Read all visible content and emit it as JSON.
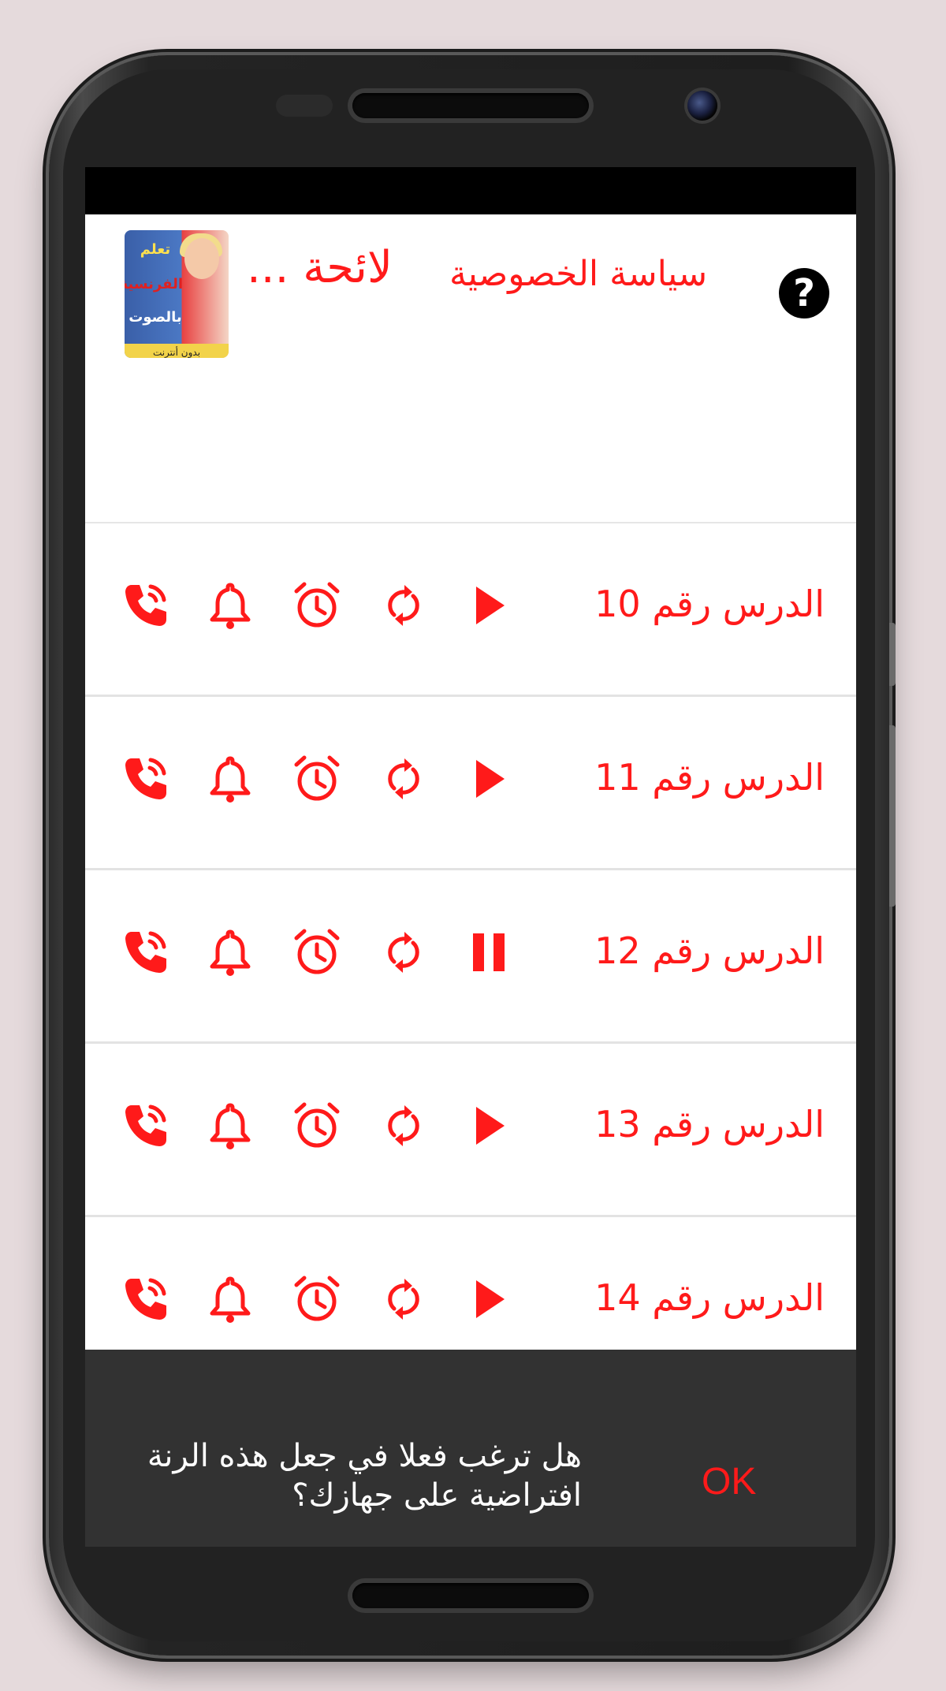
{
  "header": {
    "title": "لائحة ...",
    "privacy_label": "سياسة الخصوصية",
    "help_icon_glyph": "?",
    "logo_text": {
      "line1": "تعلم",
      "line2": "الفرنسية",
      "line3": "بالصوت",
      "bottom": "بدون أنترنت"
    }
  },
  "lessons": [
    {
      "label": "الدرس رقم 10",
      "state": "play"
    },
    {
      "label": "الدرس رقم 11",
      "state": "play"
    },
    {
      "label": "الدرس رقم 12",
      "state": "pause"
    },
    {
      "label": "الدرس رقم 13",
      "state": "play"
    },
    {
      "label": "الدرس رقم 14",
      "state": "play"
    }
  ],
  "row_icons": [
    "ringtone-call-icon",
    "notification-bell-icon",
    "alarm-clock-icon",
    "repeat-icon",
    "play-icon"
  ],
  "snackbar": {
    "message": "هل ترغب فعلا في جعل هذه الرنة افتراضية على جهازك؟",
    "ok_label": "OK"
  },
  "colors": {
    "accent": "#ff1a1a",
    "snackbar_bg": "#323232",
    "page_bg": "#e5dadc"
  }
}
